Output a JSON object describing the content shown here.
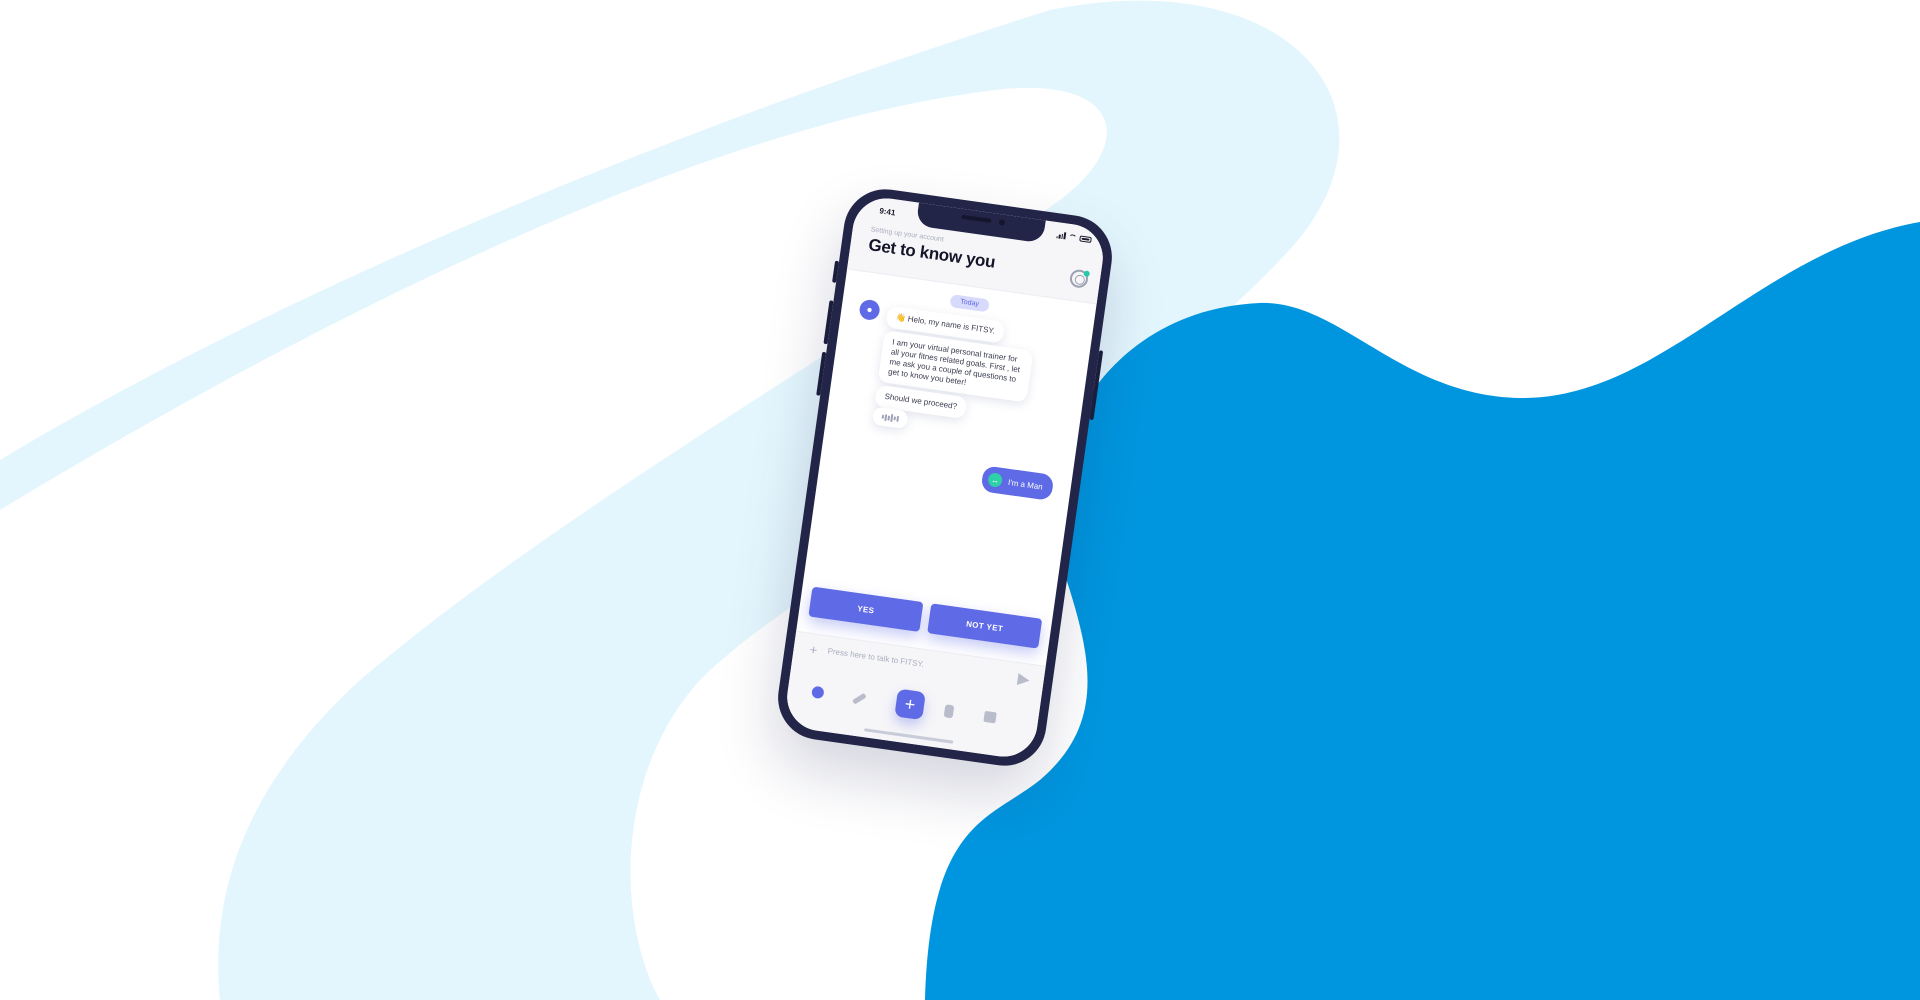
{
  "colors": {
    "accent": "#5F6BE6",
    "blob_blue": "#0096DF",
    "swoosh_light": "#E4F6FD",
    "user_avatar": "#2FCFA8"
  },
  "status_bar": {
    "time": "9:41"
  },
  "header": {
    "subtitle": "Setting up your account",
    "title": "Get to know you"
  },
  "chat": {
    "date_label": "Today",
    "bot_messages": [
      "👋 Helo, my name is FITSY.",
      "I am your virtual personal trainer for all your fitnes related goals. First , let me ask you a couple of questions to get to know you beter!",
      "Should we proceed?"
    ],
    "user_message": "I'm a Man"
  },
  "actions": {
    "yes_label": "YES",
    "not_yet_label": "NOT YET"
  },
  "composer": {
    "placeholder": "Press here to talk to FITSY."
  },
  "tabbar": {
    "icons": [
      "kettlebell-icon",
      "dumbbell-icon",
      "plus-icon",
      "bottle-icon",
      "box-icon"
    ],
    "center_symbol": "+"
  }
}
